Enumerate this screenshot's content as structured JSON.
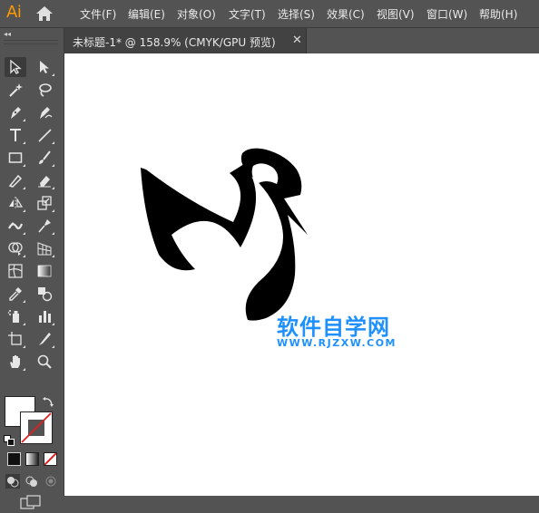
{
  "app": {
    "logo_text": "Ai"
  },
  "menu": {
    "items": [
      "文件(F)",
      "编辑(E)",
      "对象(O)",
      "文字(T)",
      "选择(S)",
      "效果(C)",
      "视图(V)",
      "窗口(W)",
      "帮助(H)"
    ]
  },
  "toolbar": {
    "collapse_glyph": "◂◂"
  },
  "tab": {
    "label": "未标题-1* @ 158.9% (CMYK/GPU 预览)",
    "close_glyph": "✕"
  },
  "colors": {
    "fill": "#ffffff",
    "stroke": "none",
    "accent": "#ff9a00",
    "watermark": "#1e90ff"
  },
  "watermark": {
    "title": "软件自学网",
    "url": "WWW.RJZXW.COM"
  }
}
